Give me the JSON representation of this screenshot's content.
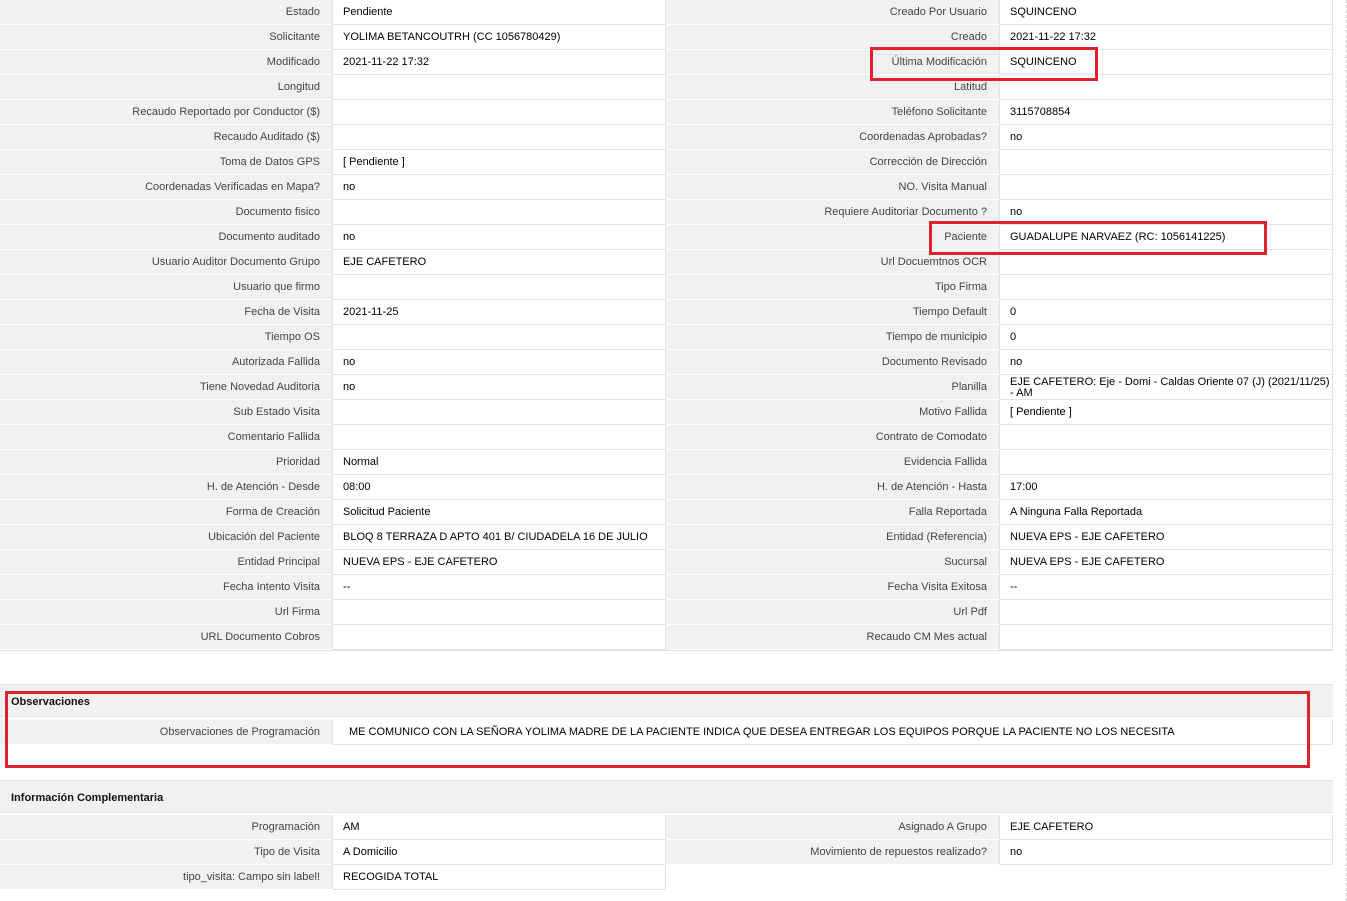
{
  "main_fields": [
    {
      "l1": "Estado",
      "v1": "Pendiente",
      "l2": "Creado Por Usuario",
      "v2": "SQUINCENO"
    },
    {
      "l1": "Solicitante",
      "v1": "YOLIMA BETANCOUTRH (CC 1056780429)",
      "l2": "Creado",
      "v2": "2021-11-22 17:32"
    },
    {
      "l1": "Modificado",
      "v1": "2021-11-22 17:32",
      "l2": "Última Modificación",
      "v2": "SQUINCENO"
    },
    {
      "l1": "Longitud",
      "v1": "",
      "l2": "Latitud",
      "v2": ""
    },
    {
      "l1": "Recaudo Reportado por Conductor ($)",
      "v1": "",
      "l2": "Teléfono Solicitante",
      "v2": "3115708854"
    },
    {
      "l1": "Recaudo Auditado ($)",
      "v1": "",
      "l2": "Coordenadas Aprobadas?",
      "v2": "no"
    },
    {
      "l1": "Toma de Datos GPS",
      "v1": "[ Pendiente ]",
      "l2": "Corrección de Dirección",
      "v2": ""
    },
    {
      "l1": "Coordenadas Verificadas en Mapa?",
      "v1": "no",
      "l2": "NO. Visita Manual",
      "v2": ""
    },
    {
      "l1": "Documento fisico",
      "v1": "",
      "l2": "Requiere Auditoriar Documento ?",
      "v2": "no"
    },
    {
      "l1": "Documento auditado",
      "v1": "no",
      "l2": "Paciente",
      "v2": "GUADALUPE NARVAEZ (RC: 1056141225)"
    },
    {
      "l1": "Usuario Auditor Documento Grupo",
      "v1": "EJE CAFETERO",
      "l2": "Url Docuemtnos OCR",
      "v2": ""
    },
    {
      "l1": "Usuario que firmo",
      "v1": "",
      "l2": "Tipo Firma",
      "v2": ""
    },
    {
      "l1": "Fecha de Visita",
      "v1": "2021-11-25",
      "l2": "Tiempo Default",
      "v2": "0"
    },
    {
      "l1": "Tiempo OS",
      "v1": "",
      "l2": "Tiempo de municipio",
      "v2": "0"
    },
    {
      "l1": "Autorizada Fallida",
      "v1": "no",
      "l2": "Documento Revisado",
      "v2": "no"
    },
    {
      "l1": "Tiene Novedad Auditoria",
      "v1": "no",
      "l2": "Planilla",
      "v2": "EJE CAFETERO: Eje - Domi - Caldas Oriente 07 (J) (2021/11/25) - AM"
    },
    {
      "l1": "Sub Estado Visita",
      "v1": "",
      "l2": "Motivo Fallida",
      "v2": "[ Pendiente ]"
    },
    {
      "l1": "Comentario Fallida",
      "v1": "",
      "l2": "Contrato de Comodato",
      "v2": ""
    },
    {
      "l1": "Prioridad",
      "v1": "Normal",
      "l2": "Evidencia Fallida",
      "v2": ""
    },
    {
      "l1": "H. de Atención - Desde",
      "v1": "08:00",
      "l2": "H. de Atención - Hasta",
      "v2": "17:00"
    },
    {
      "l1": "Forma de Creación",
      "v1": "Solicitud Paciente",
      "l2": "Falla Reportada",
      "v2": "A Ninguna Falla Reportada"
    },
    {
      "l1": "Ubicación del Paciente",
      "v1": "BLOQ 8 TERRAZA D APTO 401 B/ CIUDADELA 16 DE JULIO",
      "l2": "Entidad (Referencia)",
      "v2": "NUEVA EPS - EJE CAFETERO"
    },
    {
      "l1": "Entidad Principal",
      "v1": "NUEVA EPS - EJE CAFETERO",
      "l2": "Sucursal",
      "v2": "NUEVA EPS - EJE CAFETERO"
    },
    {
      "l1": "Fecha Intento Visita",
      "v1": "--",
      "l2": "Fecha Visita Exitosa",
      "v2": "--"
    },
    {
      "l1": "Url Firma",
      "v1": "",
      "l2": "Url Pdf",
      "v2": ""
    },
    {
      "l1": "URL Documento Cobros",
      "v1": "",
      "l2": "Recaudo CM Mes actual",
      "v2": ""
    }
  ],
  "observaciones": {
    "title": "Observaciones",
    "label": "Observaciones de Programación",
    "value": "ME COMUNICO CON LA SEÑORA YOLIMA MADRE DE LA PACIENTE INDICA QUE DESEA ENTREGAR LOS EQUIPOS PORQUE LA PACIENTE NO LOS NECESITA"
  },
  "info_complementaria": {
    "title": "Información Complementaria",
    "rows": [
      {
        "l1": "Programación",
        "v1": "AM",
        "l2": "Asignado A Grupo",
        "v2": "EJE CAFETERO"
      },
      {
        "l1": "Tipo de Visita",
        "v1": "A Domicilio",
        "l2": "Movimiento de repuestos realizado?",
        "v2": "no"
      },
      {
        "l1": "tipo_visita: Campo sin label!",
        "v1": "RECOGIDA TOTAL",
        "l2": "",
        "v2": ""
      }
    ]
  },
  "highlight_color": "#e0202c"
}
